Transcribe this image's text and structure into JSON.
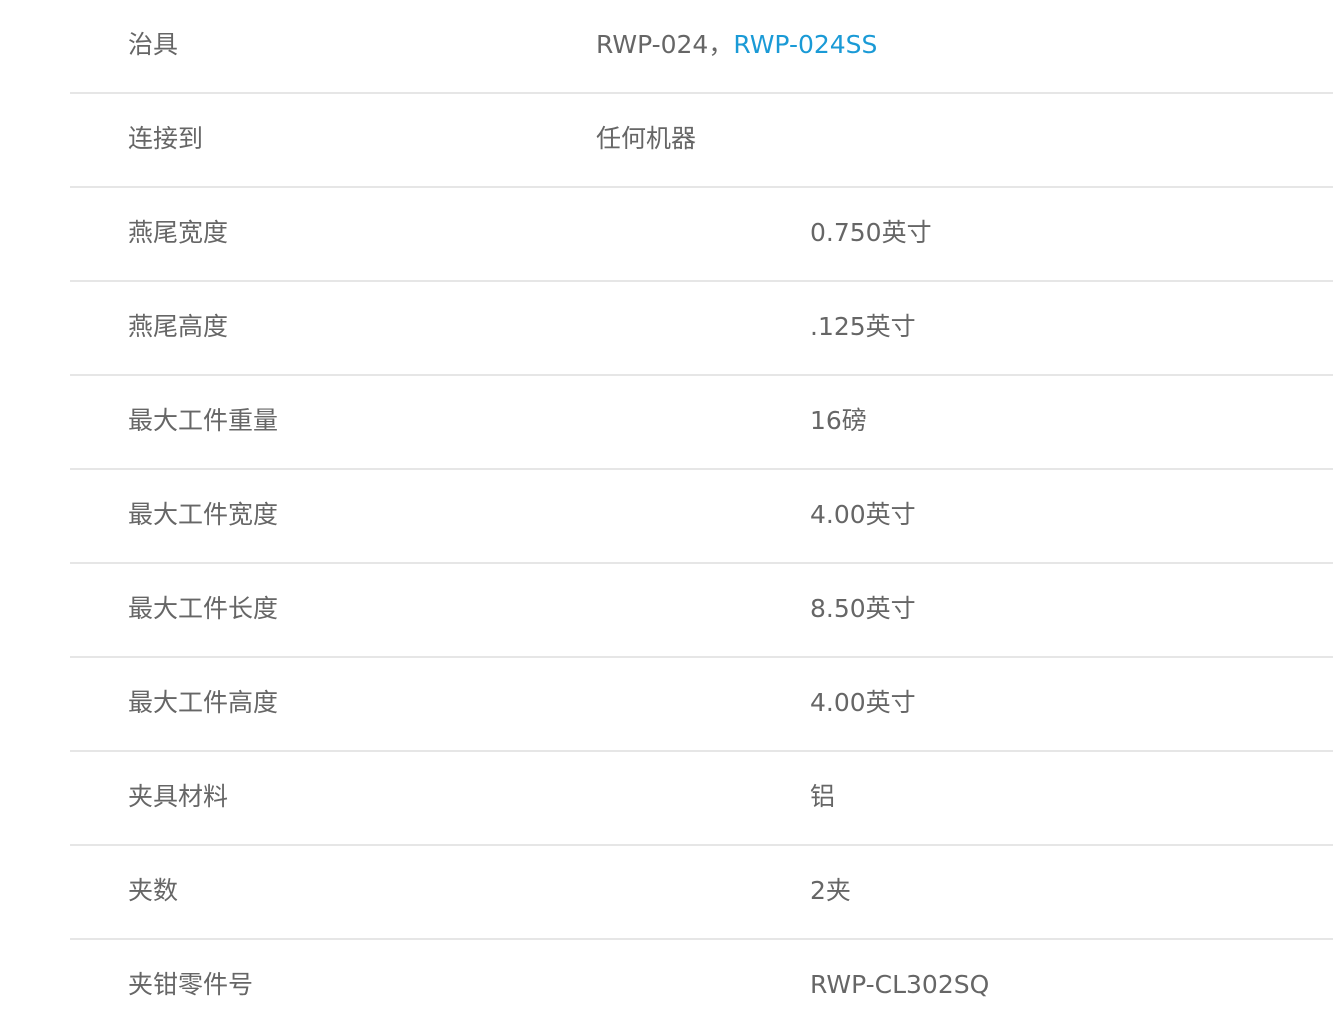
{
  "specs": [
    {
      "label": "治具",
      "value": "RWP-024，",
      "link": "RWP-024SS"
    },
    {
      "label": "连接到",
      "value": "任何机器"
    },
    {
      "label": "燕尾宽度",
      "value": "0.750英寸"
    },
    {
      "label": "燕尾高度",
      "value": ".125英寸"
    },
    {
      "label": "最大工件重量",
      "value": "16磅"
    },
    {
      "label": "最大工件宽度",
      "value": "4.00英寸"
    },
    {
      "label": "最大工件长度",
      "value": "8.50英寸"
    },
    {
      "label": "最大工件高度",
      "value": "4.00英寸"
    },
    {
      "label": "夹具材料",
      "value": "铝"
    },
    {
      "label": "夹数",
      "value": "2夹"
    },
    {
      "label": "夹钳零件号",
      "value": "RWP-CL302SQ"
    }
  ],
  "colors": {
    "text": "#666666",
    "link": "#1a9ad6",
    "divider": "#e6e6e6"
  }
}
